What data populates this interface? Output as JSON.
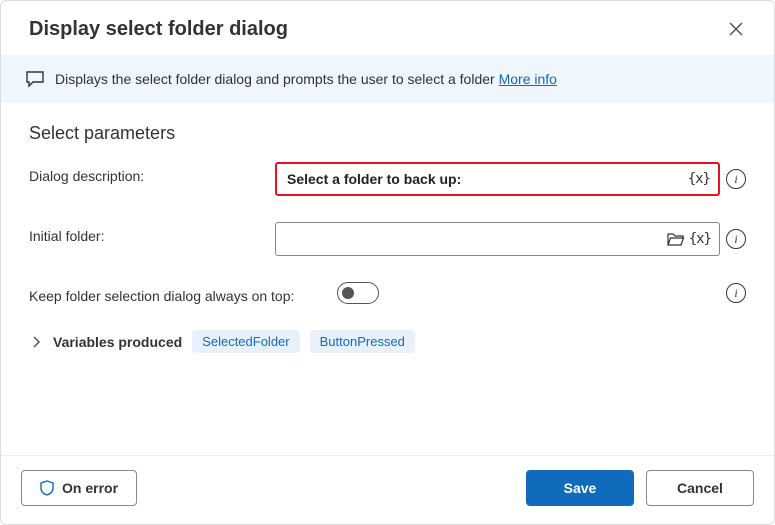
{
  "header": {
    "title": "Display select folder dialog"
  },
  "info": {
    "text": "Displays the select folder dialog and prompts the user to select a folder",
    "link_label": "More info"
  },
  "section": {
    "title": "Select parameters"
  },
  "fields": {
    "description": {
      "label": "Dialog description:",
      "value": "Select a folder to back up:",
      "var_glyph": "{x}"
    },
    "initial_folder": {
      "label": "Initial folder:",
      "value": "",
      "var_glyph": "{x}"
    },
    "always_on_top": {
      "label": "Keep folder selection dialog always on top:",
      "value": false
    }
  },
  "variables": {
    "label": "Variables produced",
    "items": [
      "SelectedFolder",
      "ButtonPressed"
    ]
  },
  "footer": {
    "on_error": "On error",
    "save": "Save",
    "cancel": "Cancel"
  }
}
